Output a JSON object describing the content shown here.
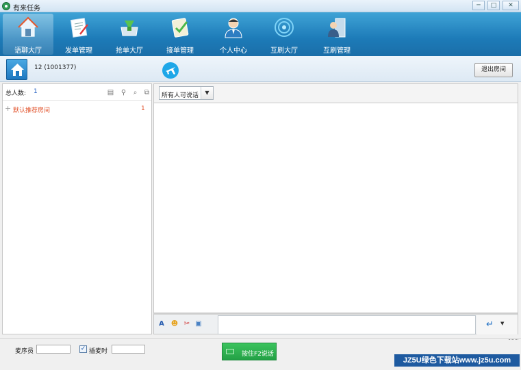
{
  "window": {
    "title": "有来任务",
    "controls": {
      "minimize": "─",
      "maximize": "□",
      "close": "✕"
    }
  },
  "nav": {
    "items": [
      {
        "label": "语聊大厅",
        "icon": "home-icon",
        "active": true
      },
      {
        "label": "发单管理",
        "icon": "document-edit-icon",
        "active": false
      },
      {
        "label": "抢单大厅",
        "icon": "funnel-icon",
        "active": false
      },
      {
        "label": "接单管理",
        "icon": "clipboard-check-icon",
        "active": false
      },
      {
        "label": "个人中心",
        "icon": "user-icon",
        "active": false
      },
      {
        "label": "互刷大厅",
        "icon": "target-icon",
        "active": false
      },
      {
        "label": "互刷管理",
        "icon": "manager-icon",
        "active": false
      }
    ]
  },
  "subbar": {
    "room_id": "12 (1001377)",
    "exit_button": "退出房间"
  },
  "left_panel": {
    "total_label": "总人数:",
    "total_count": "1",
    "rooms": [
      {
        "name": "默认推荐房间",
        "count": "1"
      }
    ]
  },
  "chat": {
    "target_select": "所有人可说话",
    "message_value": ""
  },
  "bottom": {
    "label1": "麦序员",
    "checkbox_label": "插麦时",
    "checkbox_checked": true,
    "pc_button": "按住F2说话"
  },
  "watermark": "JZ5U绿色下载站www.jz5u.com",
  "colors": {
    "nav_top": "#3fa3d6",
    "nav_bottom": "#1a6ea8",
    "room_text": "#e2542d",
    "pc_button": "#23a146",
    "watermark_bg": "#1e5aa0"
  }
}
